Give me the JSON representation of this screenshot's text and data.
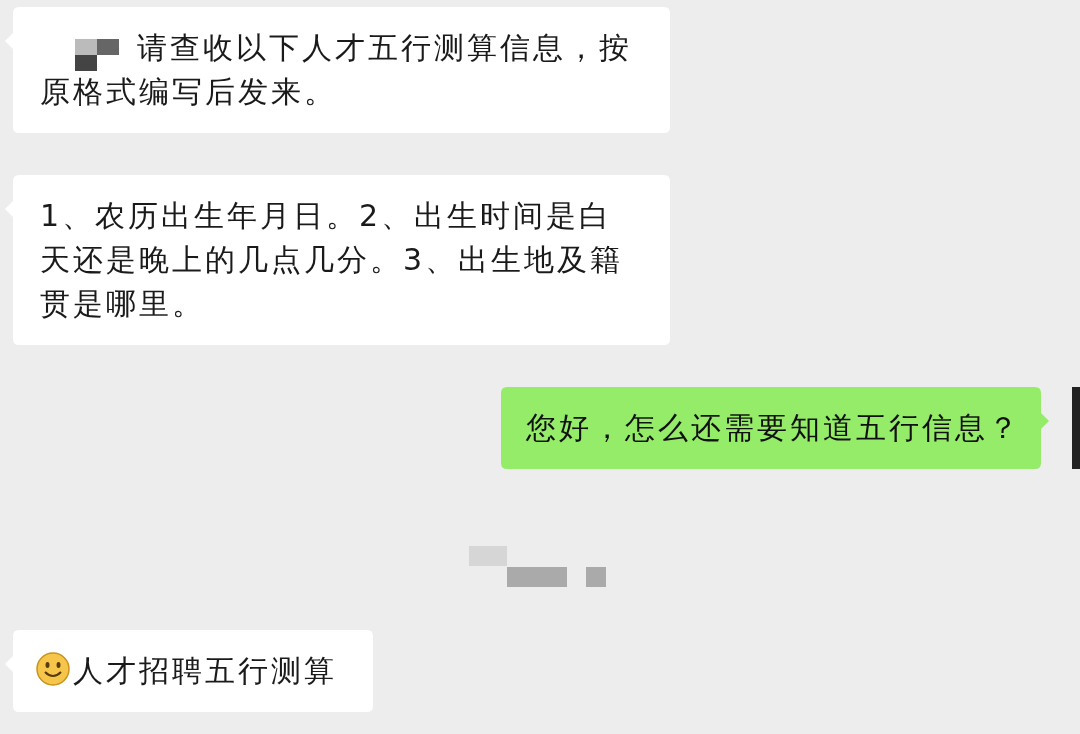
{
  "messages": [
    {
      "kind": "incoming",
      "mosaic_prefix": true,
      "text": "请查收以下人才五行测算信息，按原格式编写后发来。"
    },
    {
      "kind": "incoming",
      "text": "1、农历出生年月日。2、出生时间是白天还是晚上的几点几分。3、出生地及籍贯是哪里。"
    },
    {
      "kind": "outgoing",
      "text": "您好，怎么还需要知道五行信息？"
    },
    {
      "kind": "mosaic"
    },
    {
      "kind": "incoming",
      "smiley_prefix": true,
      "text": "人才招聘五行测算"
    }
  ]
}
